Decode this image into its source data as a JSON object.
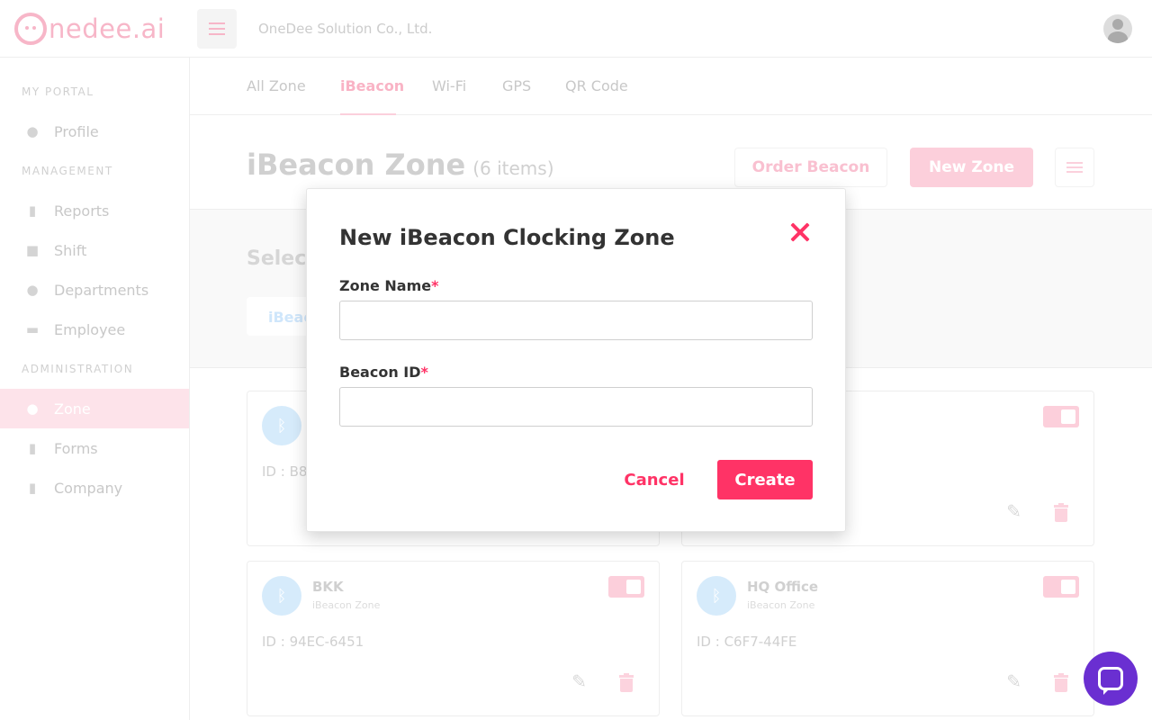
{
  "app": {
    "logo_text": "nedee.ai",
    "company": "OneDee Solution Co., Ltd."
  },
  "sidebar": {
    "sections": [
      {
        "label": "MY PORTAL",
        "items": [
          {
            "label": "Profile",
            "icon": "user-circle-icon"
          }
        ]
      },
      {
        "label": "MANAGEMENT",
        "items": [
          {
            "label": "Reports",
            "icon": "document-icon"
          },
          {
            "label": "Shift",
            "icon": "truck-clock-icon"
          },
          {
            "label": "Departments",
            "icon": "users-icon"
          },
          {
            "label": "Employee",
            "icon": "id-card-icon"
          }
        ]
      },
      {
        "label": "ADMINISTRATION",
        "items": [
          {
            "label": "Zone",
            "icon": "map-pin-icon",
            "active": true
          },
          {
            "label": "Forms",
            "icon": "clipboard-icon"
          },
          {
            "label": "Company",
            "icon": "building-icon"
          }
        ]
      }
    ]
  },
  "tabs": [
    {
      "label": "All Zone"
    },
    {
      "label": "iBeacon",
      "active": true
    },
    {
      "label": "Wi-Fi"
    },
    {
      "label": "GPS"
    },
    {
      "label": "QR Code"
    }
  ],
  "header": {
    "title": "iBeacon Zone",
    "count": "(6 items)",
    "order_button": "Order Beacon",
    "new_zone_button": "New Zone"
  },
  "select_area": {
    "label": "Select",
    "chip": "iBeac"
  },
  "cards": [
    {
      "name": "",
      "type": "",
      "id": "ID : B8"
    },
    {
      "name": "",
      "type": "",
      "id": ""
    },
    {
      "name": "BKK",
      "type": "iBeacon Zone",
      "id": "ID : 94EC-6451"
    },
    {
      "name": "HQ Office",
      "type": "iBeacon Zone",
      "id": "ID : C6F7-44FE"
    }
  ],
  "modal": {
    "title": "New iBeacon Clocking Zone",
    "zone_name_label": "Zone Name",
    "zone_name_value": "",
    "beacon_id_label": "Beacon ID",
    "beacon_id_value": "",
    "required_mark": "*",
    "cancel_label": "Cancel",
    "create_label": "Create"
  },
  "colors": {
    "accent": "#ff3366",
    "accent_faded": "#fccfdb",
    "beacon_blue": "#d6ebfb",
    "chat": "#6a2fd1"
  }
}
